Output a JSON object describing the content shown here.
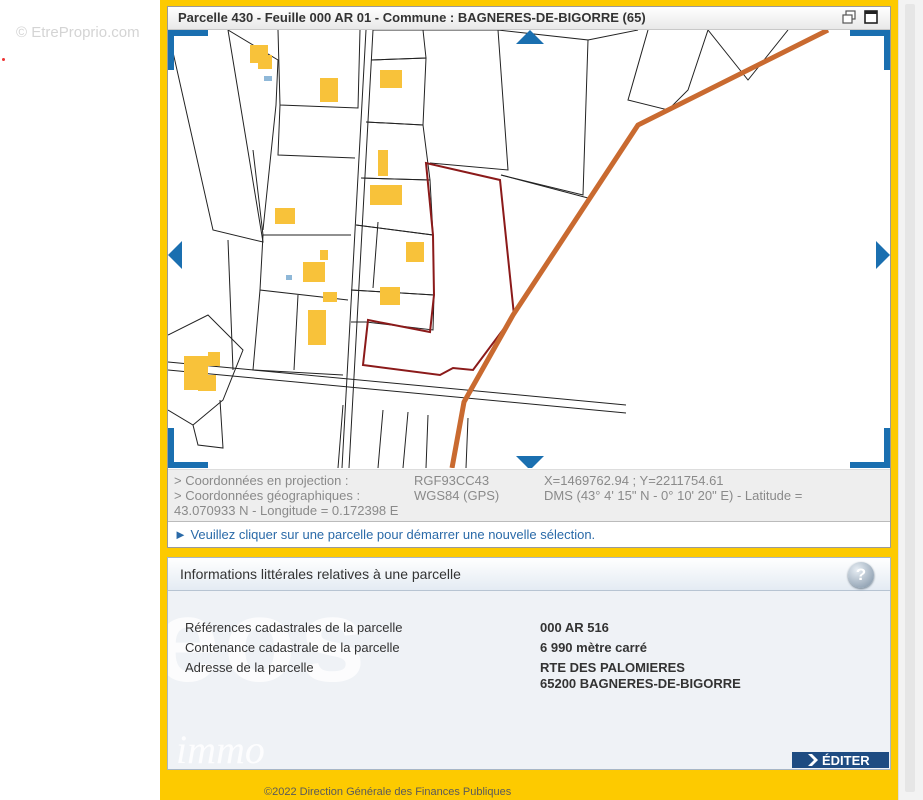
{
  "watermark": "© EtreProprio.com",
  "map_panel": {
    "title": "Parcelle 430 - Feuille 000 AR 01 - Commune : BAGNERES-DE-BIGORRE (65)"
  },
  "coordinates": {
    "projection_label": "> Coordonnées en projection :",
    "projection_system": "RGF93CC43",
    "projection_value": "X=1469762.94 ; Y=2211754.61",
    "geographic_label": "> Coordonnées géographiques :",
    "geographic_system": "WGS84 (GPS)",
    "geographic_value_line1": "DMS (43° 4' 15\" N - 0° 10' 20\" E) - Latitude =",
    "geographic_value_line2": "43.070933 N - Longitude = 0.172398 E"
  },
  "instruction": "► Veuillez cliquer sur une parcelle pour démarrer une nouvelle sélection.",
  "info_panel": {
    "title": "Informations littérales relatives à une parcelle",
    "help_glyph": "?",
    "rows": [
      {
        "label": "Références cadastrales de la parcelle",
        "value": "000 AR 516"
      },
      {
        "label": "Contenance cadastrale de la parcelle",
        "value": "6 990 mètre carré"
      },
      {
        "label": "Adresse de la parcelle",
        "value": "RTE DES PALOMIERES",
        "value2": "65200 BAGNERES-DE-BIGORRE"
      }
    ],
    "edit_label": "ÉDITER"
  },
  "footer": "©2022 Direction Générale des Finances Publiques",
  "colors": {
    "frame": "#fdca00",
    "nav_arrow": "#1a6fb0",
    "parcel_outline": "#8b1a1a",
    "road": "#c96a30",
    "building": "#f8c23a",
    "edit_button": "#1e4c82"
  }
}
